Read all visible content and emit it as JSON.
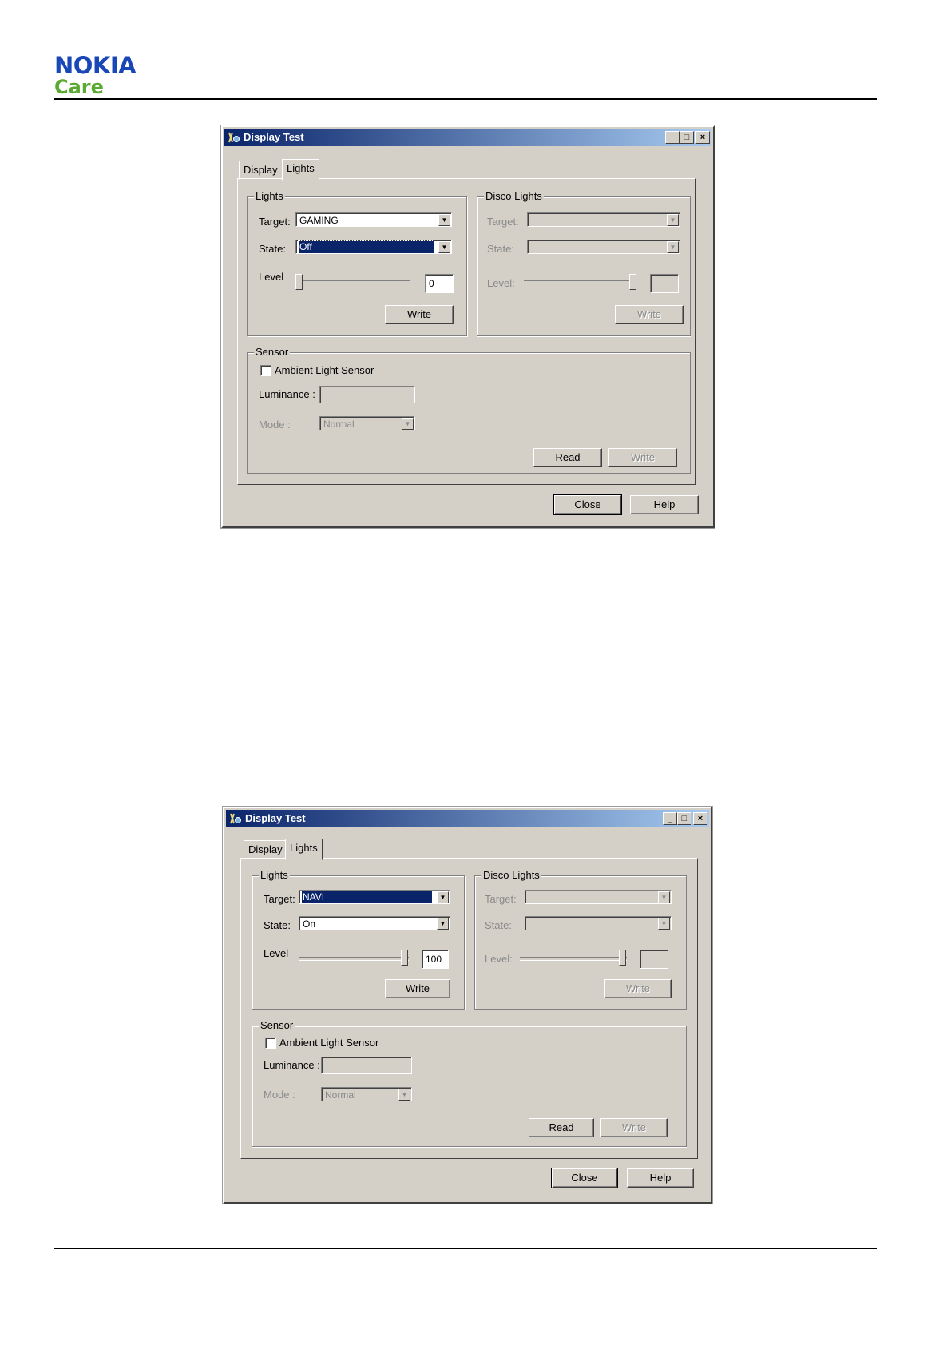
{
  "header": {
    "brand": "NOKIA",
    "sub": "Care"
  },
  "dialogs": [
    {
      "title": "Display Test",
      "tabs": [
        "Display",
        "Lights"
      ],
      "lights": {
        "legend": "Lights",
        "target_label": "Target:",
        "target_value": "GAMING",
        "state_label": "State:",
        "state_value": "Off",
        "level_label": "Level",
        "level_value": "0",
        "write": "Write"
      },
      "disco": {
        "legend": "Disco Lights",
        "target_label": "Target:",
        "state_label": "State:",
        "level_label": "Level:",
        "write": "Write"
      },
      "sensor": {
        "legend": "Sensor",
        "checkbox_label": "Ambient Light Sensor",
        "luminance_label": "Luminance :",
        "mode_label": "Mode :",
        "mode_value": "Normal",
        "read": "Read",
        "write": "Write"
      },
      "close": "Close",
      "help": "Help"
    },
    {
      "title": "Display Test",
      "tabs": [
        "Display",
        "Lights"
      ],
      "lights": {
        "legend": "Lights",
        "target_label": "Target:",
        "target_value": "NAVI",
        "state_label": "State:",
        "state_value": "On",
        "level_label": "Level",
        "level_value": "100",
        "write": "Write"
      },
      "disco": {
        "legend": "Disco Lights",
        "target_label": "Target:",
        "state_label": "State:",
        "level_label": "Level:",
        "write": "Write"
      },
      "sensor": {
        "legend": "Sensor",
        "checkbox_label": "Ambient Light Sensor",
        "luminance_label": "Luminance :",
        "mode_label": "Mode :",
        "mode_value": "Normal",
        "read": "Read",
        "write": "Write"
      },
      "close": "Close",
      "help": "Help"
    }
  ]
}
